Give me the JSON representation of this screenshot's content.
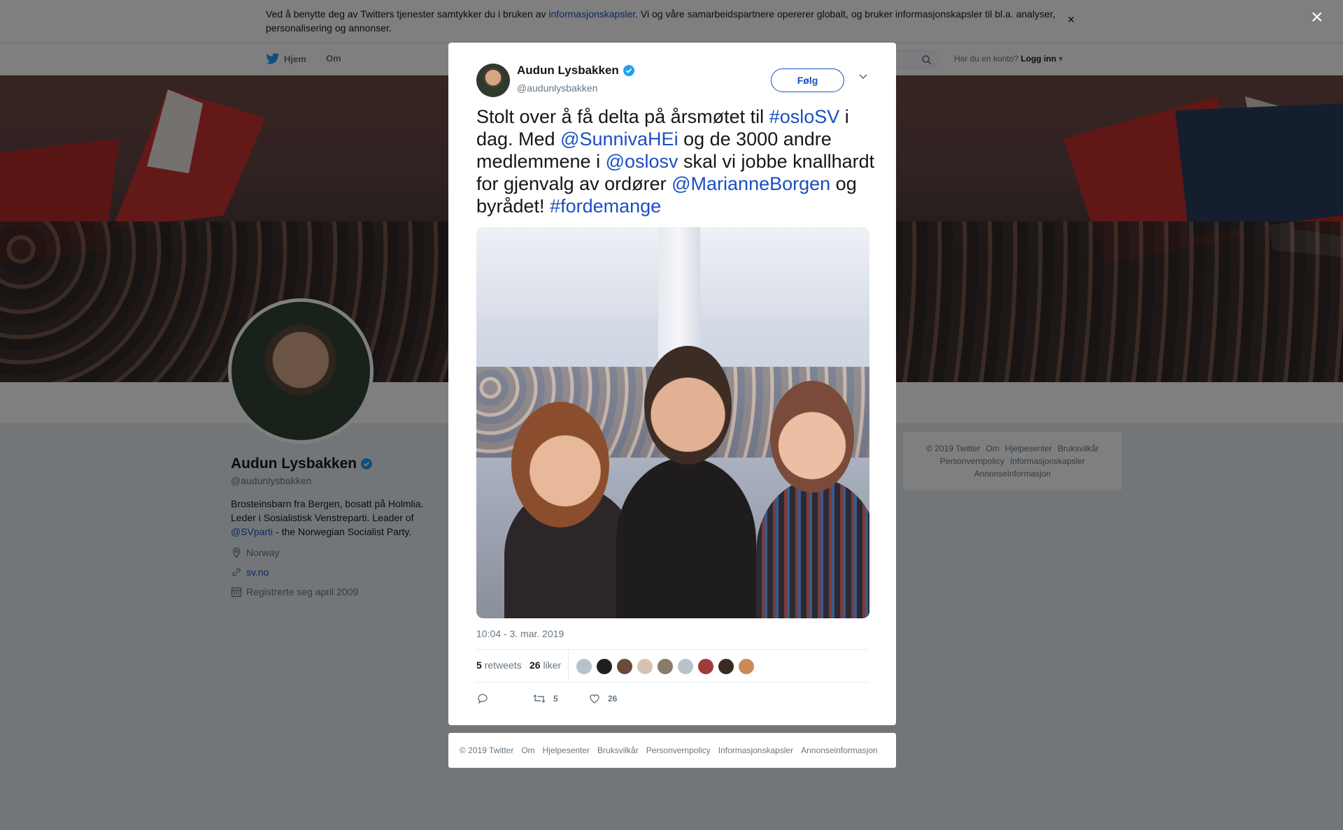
{
  "cookie_bar": {
    "text_before": "Ved å benytte deg av Twitters tjenester samtykker du i bruken av ",
    "link": "informasjonskapsler",
    "text_after": ". Vi og våre samarbeidspartnere opererer globalt, og bruker informasjonskapsler til bl.a. analyser, personalisering og annonser.",
    "close": "×"
  },
  "topnav": {
    "home": "Hjem",
    "about": "Om",
    "account_prompt": "Har du en konto?",
    "login": "Logg inn"
  },
  "profile": {
    "name": "Audun Lysbakken",
    "handle": "@audunlysbakken",
    "bio_before": "Brosteinsbarn fra Bergen, bosatt på Holmlia. Leder i Sosialistisk Venstreparti. Leader of",
    "bio_link": "@SVparti",
    "bio_after": " - the Norwegian Socialist Party.",
    "location": "Norway",
    "website": "sv.no",
    "joined": "Registrerte seg april 2009"
  },
  "side_footer": {
    "row1": [
      "© 2019 Twitter",
      "Om",
      "Hjelpesenter",
      "Bruksvilkår"
    ],
    "row2": [
      "Personvernpolicy",
      "Informasjonskapsler"
    ],
    "row3": [
      "Annonseinformasjon"
    ]
  },
  "overlay": {
    "close": "×"
  },
  "tweet": {
    "author_name": "Audun Lysbakken",
    "author_handle": "@audunlysbakken",
    "follow_label": "Følg",
    "text_parts": [
      {
        "t": "Stolt over å få delta på årsmøtet til ",
        "hl": false
      },
      {
        "t": "#osloSV",
        "hl": true
      },
      {
        "t": " i dag. Med ",
        "hl": false
      },
      {
        "t": "@SunnivaHEi",
        "hl": true
      },
      {
        "t": " og de 3000 andre medlemmene i ",
        "hl": false
      },
      {
        "t": "@oslosv",
        "hl": true
      },
      {
        "t": " skal vi jobbe knallhardt for gjenvalg av ordører ",
        "hl": false
      },
      {
        "t": "@MarianneBorgen",
        "hl": true
      },
      {
        "t": " og byrådet! ",
        "hl": false
      },
      {
        "t": "#fordemange",
        "hl": true
      }
    ],
    "timestamp": "10:04 - 3. mar. 2019",
    "retweet_count": "5",
    "retweet_label": "retweets",
    "like_count": "26",
    "like_label": "liker",
    "action_retweets": "5",
    "action_likes": "26",
    "liker_colors": [
      "#b8c2cc",
      "#1f1f1f",
      "#6b4a3a",
      "#d9c3b0",
      "#8a7a6a",
      "#b8c2cc",
      "#a33a3a",
      "#3a2a22",
      "#c98a5a"
    ]
  },
  "modal_footer": [
    "© 2019 Twitter",
    "Om",
    "Hjelpesenter",
    "Bruksvilkår",
    "Personvernpolicy",
    "Informasjonskapsler",
    "Annonseinformasjon"
  ],
  "colors": {
    "link": "#1b4fc2",
    "verified": "#1da1f2",
    "muted": "#657786"
  }
}
